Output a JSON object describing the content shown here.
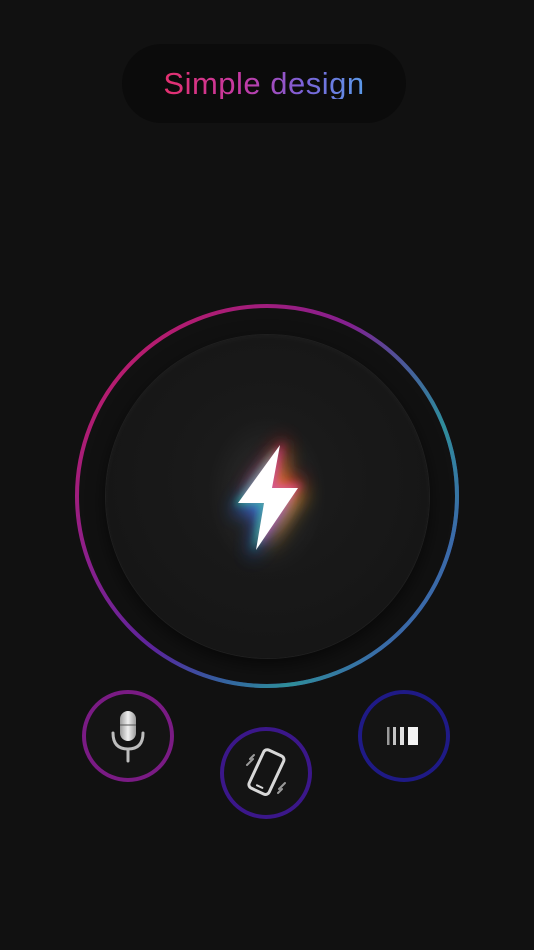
{
  "header": {
    "title": "Simple design"
  },
  "colors": {
    "background": "#111111",
    "ring_gradient": [
      "#d41a5a",
      "#8a1f8c",
      "#3a2aa8",
      "#2f8f9a"
    ],
    "mic_ring": "#7a1b84",
    "vibrate_ring": "#3b178a",
    "strobe_ring": "#1f1a86"
  },
  "icons": {
    "power": "lightning-bolt-icon",
    "microphone": "microphone-icon",
    "vibrate": "vibrate-phone-icon",
    "strobe": "strobe-bars-icon"
  }
}
